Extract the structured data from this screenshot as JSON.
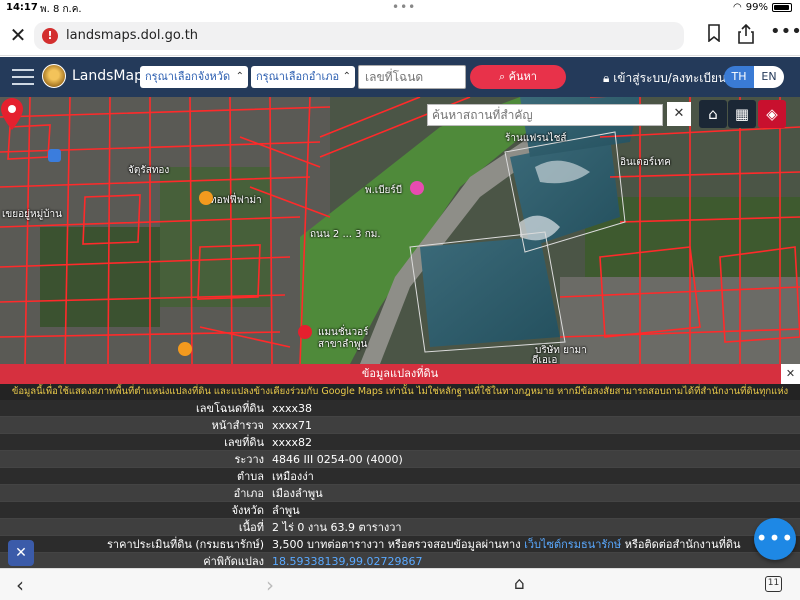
{
  "status_bar": {
    "time": "14:17",
    "date": "พ. 8 ก.ค.",
    "battery": "99%"
  },
  "browser": {
    "url": "landsmaps.dol.go.th",
    "tab_count": "11"
  },
  "header": {
    "brand": "LandsMaps",
    "province_select": "กรุณาเลือกจังหวัด",
    "district_select": "กรุณาเลือกอำเภอ",
    "parcel_placeholder": "เลขที่โฉนด",
    "search_label": "ค้นหา",
    "login_label": "เข้าสู่ระบบ/ลงทะเบียน",
    "lang_th": "TH",
    "lang_en": "EN"
  },
  "map": {
    "search_placeholder": "ค้นหาสถานที่สำคัญ",
    "labels": {
      "shop": "ทอฟฟี่ฟาม่า",
      "place1": "จัตุรัสทอง",
      "place2": "เขยอยู่หมู่บ้าน",
      "place3": "พ.เบียร์บี",
      "place4": "ถนน 2 ... 3 กม.",
      "place5": "ร้านแฟรนไชส์",
      "place6": "อินเตอร์เทค",
      "place7": "แมนชั่นวอร์",
      "place8": "สาขาลำพูน",
      "place9": "บริษัท ยามา",
      "place10": "ดีเอเอ"
    }
  },
  "info": {
    "title": "ข้อมูลแปลงที่ดิน",
    "notice": "ข้อมูลนี้เพื่อใช้แสดงสภาพพื้นที่ตำแหน่งแปลงที่ดิน และแปลงข้างเคียงร่วมกับ Google Maps เท่านั้น ไม่ใช่หลักฐานที่ใช้ในทางกฎหมาย หากมีข้อสงสัยสามารถสอบถามได้ที่สำนักงานที่ดินทุกแห่ง",
    "rows": [
      {
        "key": "เลขโฉนดที่ดิน",
        "value": "xxxx38"
      },
      {
        "key": "หน้าสำรวจ",
        "value": "xxxx71"
      },
      {
        "key": "เลขที่ดิน",
        "value": "xxxx82"
      },
      {
        "key": "ระวาง",
        "value": "4846 III 0254-00 (4000)"
      },
      {
        "key": "ตำบล",
        "value": "เหมืองง่า"
      },
      {
        "key": "อำเภอ",
        "value": "เมืองลำพูน"
      },
      {
        "key": "จังหวัด",
        "value": "ลำพูน"
      },
      {
        "key": "เนื้อที่",
        "value": "2 ไร่ 0 งาน 63.9 ตารางวา"
      },
      {
        "key": "ราคาประเมินที่ดิน (กรมธนารักษ์)",
        "value_pre": "3,500 บาทต่อตารางวา หรือตรวจสอบข้อมูลผ่านทาง",
        "value_link": "เว็บไซต์กรมธนารักษ์",
        "value_post": "หรือติดต่อสำนักงานที่ดิน"
      },
      {
        "key": "ค่าพิกัดแปลง",
        "value_link": "18.59338139,99.02729867"
      }
    ]
  },
  "colors": {
    "header_bg": "#243a5a",
    "accent_red": "#e8324a",
    "parcel_line": "#ff2a2a",
    "link": "#5aa9ff"
  }
}
